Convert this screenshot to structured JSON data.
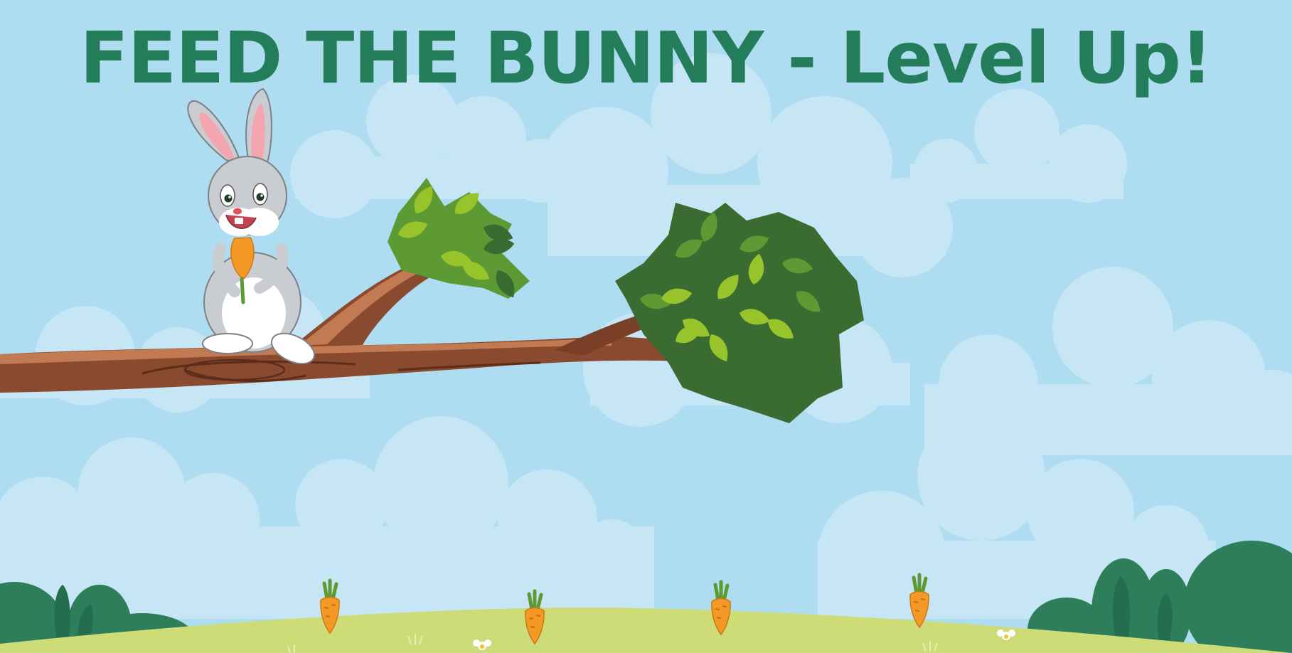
{
  "title": "FEED THE BUNNY - Level Up!",
  "colors": {
    "sky": "#aedcf0",
    "cloud": "#c6e6f5",
    "title": "#237d5a",
    "hill": "#cddc77",
    "bush": "#2e7e5c",
    "bush_dark": "#246d4e",
    "branch": "#8a4a2f",
    "branch_light": "#c27a52",
    "leaf_dark": "#3a6b30",
    "leaf_mid": "#5d9a34",
    "leaf_light": "#97c42b",
    "carrot": "#f29a25",
    "bunny": "#c9cdd2"
  },
  "scene": {
    "character": "bunny",
    "held_item": "carrot",
    "ground_item": "carrot",
    "ground_item_count": 4
  }
}
